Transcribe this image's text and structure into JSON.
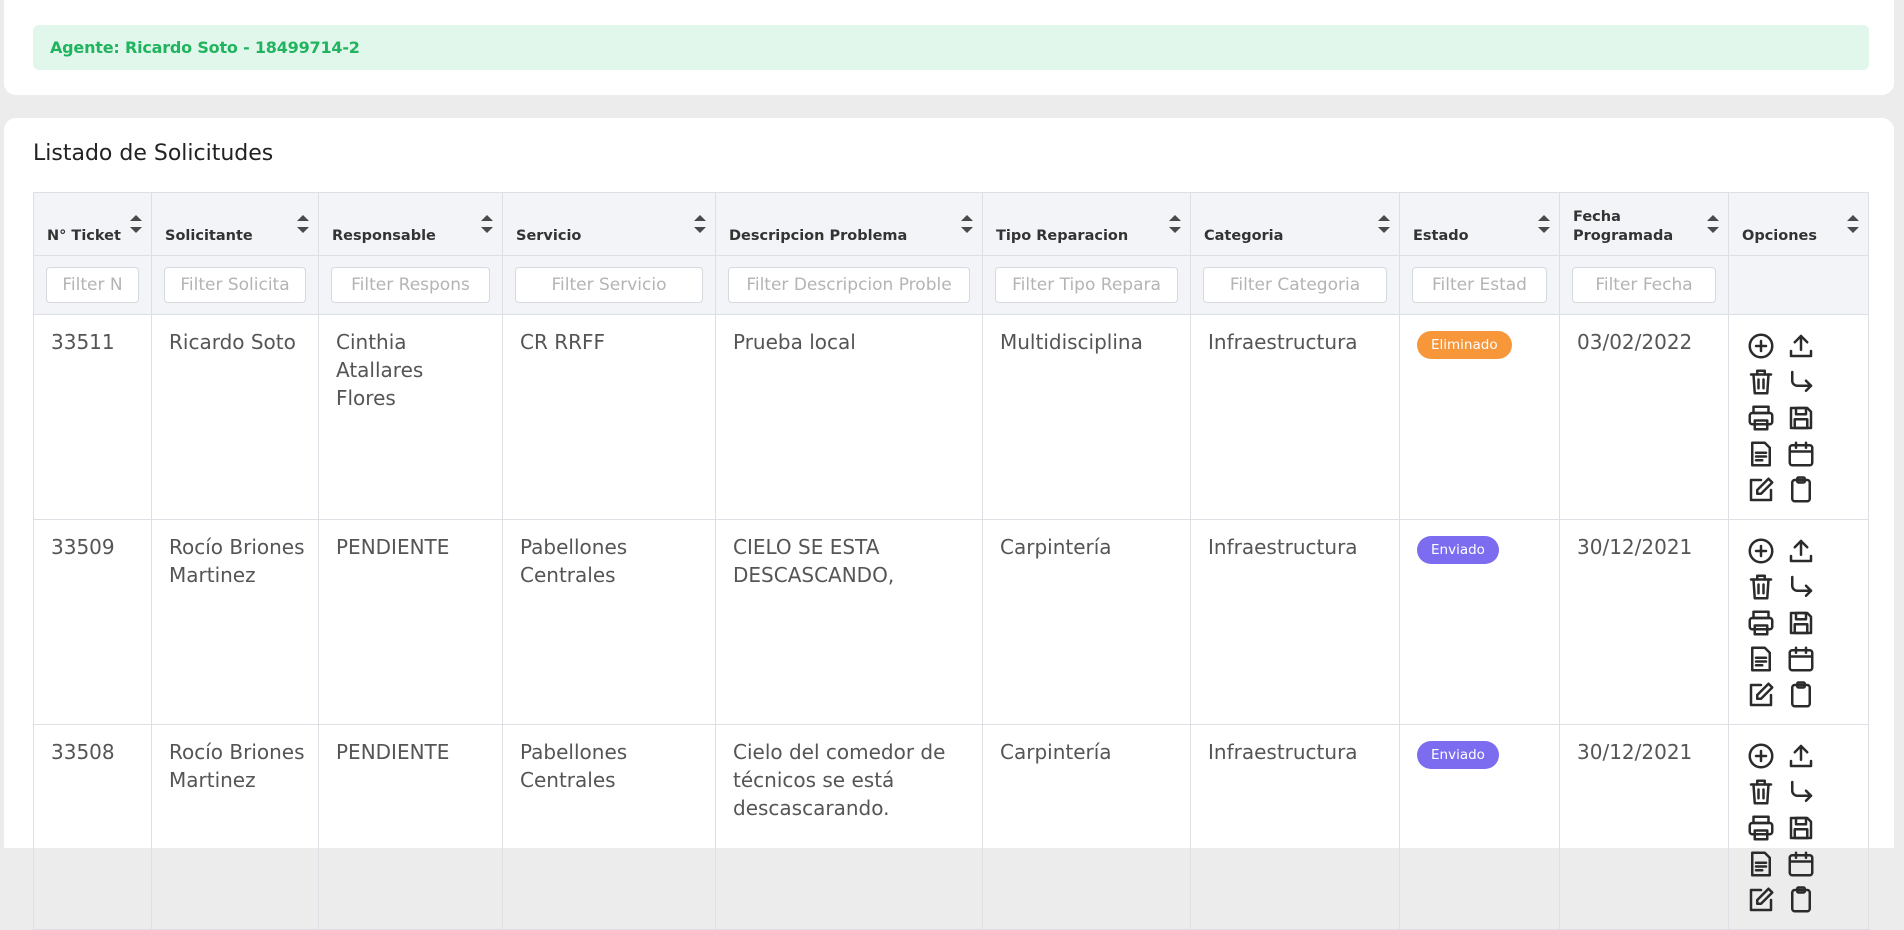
{
  "agent": {
    "text": "Agente: Ricardo Soto - 18499714-2"
  },
  "list": {
    "title": "Listado de Solicitudes"
  },
  "columns": [
    {
      "label": "N° Ticket",
      "placeholder": "Filter N"
    },
    {
      "label": "Solicitante",
      "placeholder": "Filter Solicita"
    },
    {
      "label": "Responsable",
      "placeholder": "Filter Respons"
    },
    {
      "label": "Servicio",
      "placeholder": "Filter Servicio"
    },
    {
      "label": "Descripcion Problema",
      "placeholder": "Filter Descripcion Proble"
    },
    {
      "label": "Tipo Reparacion",
      "placeholder": "Filter Tipo Repara"
    },
    {
      "label": "Categoria",
      "placeholder": "Filter Categoria"
    },
    {
      "label": "Estado",
      "placeholder": "Filter Estad"
    },
    {
      "label": "Fecha Programada",
      "placeholder": "Filter Fecha"
    },
    {
      "label": "Opciones",
      "placeholder": ""
    }
  ],
  "rows": [
    {
      "ticket": "33511",
      "solicitante": "Ricardo Soto",
      "responsable": "Cinthia Atallares Flores",
      "servicio": "CR RRFF",
      "descripcion": "Prueba local",
      "tipo": "Multidisciplina",
      "categoria": "Infraestructura",
      "estado": "Eliminado",
      "fecha": "03/02/2022"
    },
    {
      "ticket": "33509",
      "solicitante": "Rocío Briones Martinez",
      "responsable": "PENDIENTE",
      "servicio": "Pabellones Centrales",
      "descripcion": "CIELO SE ESTA DESCASCANDO,",
      "tipo": "Carpintería",
      "categoria": "Infraestructura",
      "estado": "Enviado",
      "fecha": "30/12/2021"
    },
    {
      "ticket": "33508",
      "solicitante": "Rocío Briones Martinez",
      "responsable": "PENDIENTE",
      "servicio": "Pabellones Centrales",
      "descripcion": "Cielo del comedor de técnicos se está descascarando.",
      "tipo": "Carpintería",
      "categoria": "Infraestructura",
      "estado": "Enviado",
      "fecha": "30/12/2021"
    }
  ],
  "status_colors": {
    "Eliminado": "#f7973a",
    "Enviado": "#7b6cf0"
  },
  "alert_colors": {
    "background": "#e2f7ec",
    "text": "#21b45f"
  },
  "option_icons": [
    "add-circle-icon",
    "upload-icon",
    "trash-icon",
    "forward-arrow-icon",
    "printer-icon",
    "save-icon",
    "document-icon",
    "calendar-icon",
    "edit-icon",
    "clipboard-icon"
  ]
}
